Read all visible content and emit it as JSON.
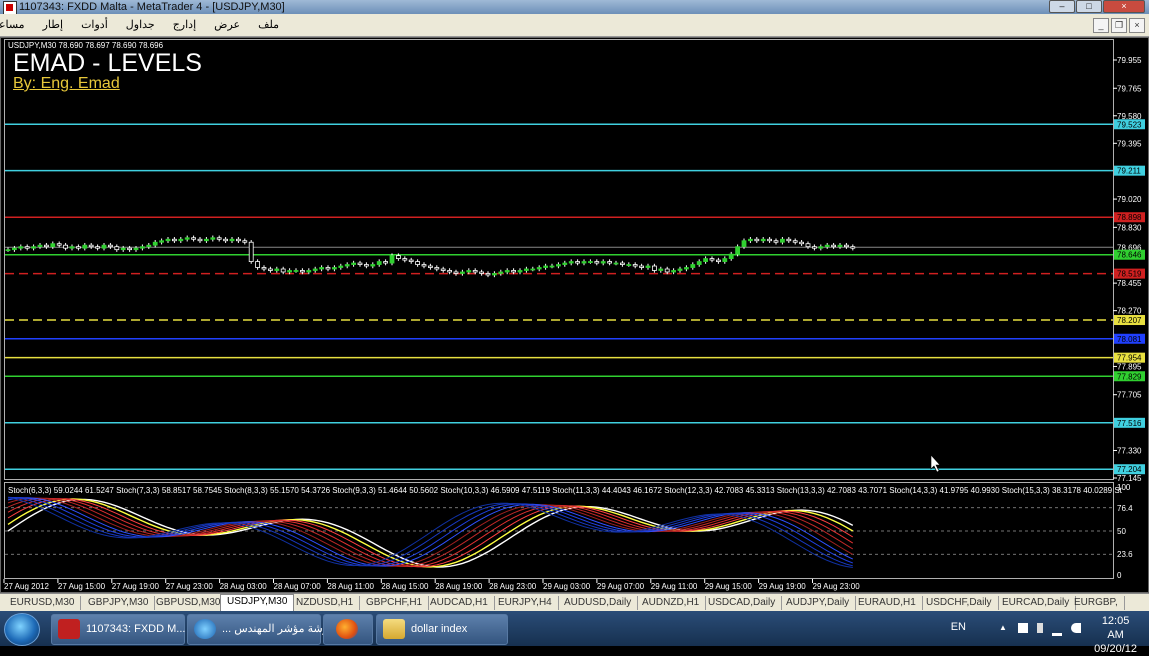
{
  "window": {
    "title": "1107343: FXDD Malta - MetaTrader 4 - [USDJPY,M30]"
  },
  "menu": {
    "items": [
      "ملف",
      "عرض",
      "إدارج",
      "جداول",
      "أدوات",
      "إطار",
      "مساعدة"
    ]
  },
  "chart": {
    "symbol_line": "USDJPY,M30  78.690 78.697 78.690 78.696",
    "title": "EMAD - LEVELS",
    "byline": "By: Eng. Emad",
    "price_ticks": [
      "79.955",
      "79.765",
      "79.580",
      "79.395",
      "79.020",
      "78.830",
      "78.455",
      "78.270",
      "77.895",
      "77.705",
      "77.330",
      "77.145"
    ],
    "level_tags": [
      {
        "label": "79.523",
        "color": "#40d0e0"
      },
      {
        "label": "79.211",
        "color": "#40d0e0"
      },
      {
        "label": "78.898",
        "color": "#d02020"
      },
      {
        "label": "78.696",
        "color": "#ffffff"
      },
      {
        "label": "78.646",
        "color": "#30d030"
      },
      {
        "label": "78.519",
        "color": "#d02020"
      },
      {
        "label": "78.207",
        "color": "#e8e040"
      },
      {
        "label": "78.081",
        "color": "#2040ff"
      },
      {
        "label": "77.954",
        "color": "#e8e040"
      },
      {
        "label": "77.829",
        "color": "#30d030"
      },
      {
        "label": "77.516",
        "color": "#40d0e0"
      },
      {
        "label": "77.204",
        "color": "#40d0e0"
      }
    ],
    "stoch_header": "Stoch(6,3,3) 59.0244 61.5247  Stoch(7,3,3) 58.8517 58.7545  Stoch(8,3,3) 55.1570 54.3726  Stoch(9,3,3) 51.4644 50.5602  Stoch(10,3,3) 46.5909 47.5119  Stoch(11,3,3) 44.4043 46.1672  Stoch(12,3,3) 42.7083 45.3313  Stoch(13,3,3) 42.7083 43.7071  Stoch(14,3,3) 41.9795 40.9930  Stoch(15,3,3) 38.3178 40.0289  St",
    "stoch_ticks": [
      "100",
      "76.4",
      "50",
      "23.6",
      "0"
    ],
    "time_labels": [
      "27 Aug 2012",
      "27 Aug 15:00",
      "27 Aug 19:00",
      "27 Aug 23:00",
      "28 Aug 03:00",
      "28 Aug 07:00",
      "28 Aug 11:00",
      "28 Aug 15:00",
      "28 Aug 19:00",
      "28 Aug 23:00",
      "29 Aug 03:00",
      "29 Aug 07:00",
      "29 Aug 11:00",
      "29 Aug 15:00",
      "29 Aug 19:00",
      "29 Aug 23:00"
    ],
    "candle_closes": [
      78.68,
      78.69,
      78.7,
      78.69,
      78.7,
      78.71,
      78.7,
      78.72,
      78.71,
      78.69,
      78.7,
      78.69,
      78.71,
      78.7,
      78.69,
      78.71,
      78.7,
      78.68,
      78.69,
      78.68,
      78.69,
      78.7,
      78.71,
      78.73,
      78.74,
      78.75,
      78.74,
      78.75,
      78.76,
      78.75,
      78.74,
      78.75,
      78.76,
      78.75,
      78.74,
      78.75,
      78.74,
      78.73,
      78.6,
      78.56,
      78.55,
      78.54,
      78.55,
      78.53,
      78.54,
      78.54,
      78.53,
      78.54,
      78.55,
      78.56,
      78.55,
      78.56,
      78.57,
      78.58,
      78.59,
      78.58,
      78.57,
      78.58,
      78.6,
      78.59,
      78.64,
      78.62,
      78.61,
      78.6,
      78.58,
      78.57,
      78.56,
      78.55,
      78.54,
      78.53,
      78.52,
      78.53,
      78.54,
      78.53,
      78.52,
      78.51,
      78.52,
      78.53,
      78.54,
      78.53,
      78.54,
      78.55,
      78.55,
      78.56,
      78.57,
      78.57,
      78.58,
      78.59,
      78.6,
      78.59,
      78.6,
      78.6,
      78.59,
      78.6,
      78.59,
      78.59,
      78.58,
      78.58,
      78.57,
      78.56,
      78.57,
      78.54,
      78.55,
      78.53,
      78.54,
      78.55,
      78.56,
      78.58,
      78.6,
      78.62,
      78.61,
      78.6,
      78.62,
      78.65,
      78.7,
      78.74,
      78.75,
      78.74,
      78.75,
      78.74,
      78.73,
      78.75,
      78.74,
      78.73,
      78.72,
      78.7,
      78.69,
      78.7,
      78.71,
      78.7,
      78.71,
      78.7,
      78.69
    ]
  },
  "symbol_tabs": [
    "EURUSD,M30",
    "GBPJPY,M30",
    "GBPUSD,M30",
    "USDJPY,M30",
    "NZDUSD,H1",
    "GBPCHF,H1",
    "AUDCAD,H1",
    "EURJPY,H4",
    "AUDUSD,Daily",
    "AUDNZD,H1",
    "USDCAD,Daily",
    "AUDJPY,Daily",
    "EURAUD,H1",
    "USDCHF,Daily",
    "EURCAD,Daily",
    "EURGBP,"
  ],
  "active_tab": "USDJPY,M30",
  "taskbar": {
    "buttons": [
      {
        "label": "1107343: FXDD M...",
        "icon": "mt4-icon"
      },
      {
        "label": "... ورشة مؤشر المهندس",
        "icon": "ie-icon"
      },
      {
        "label": "",
        "icon": "firefox-icon"
      },
      {
        "label": "dollar index",
        "icon": "folder-icon"
      }
    ],
    "lang": "EN",
    "time": "12:05 AM",
    "date": "09/20/12"
  }
}
